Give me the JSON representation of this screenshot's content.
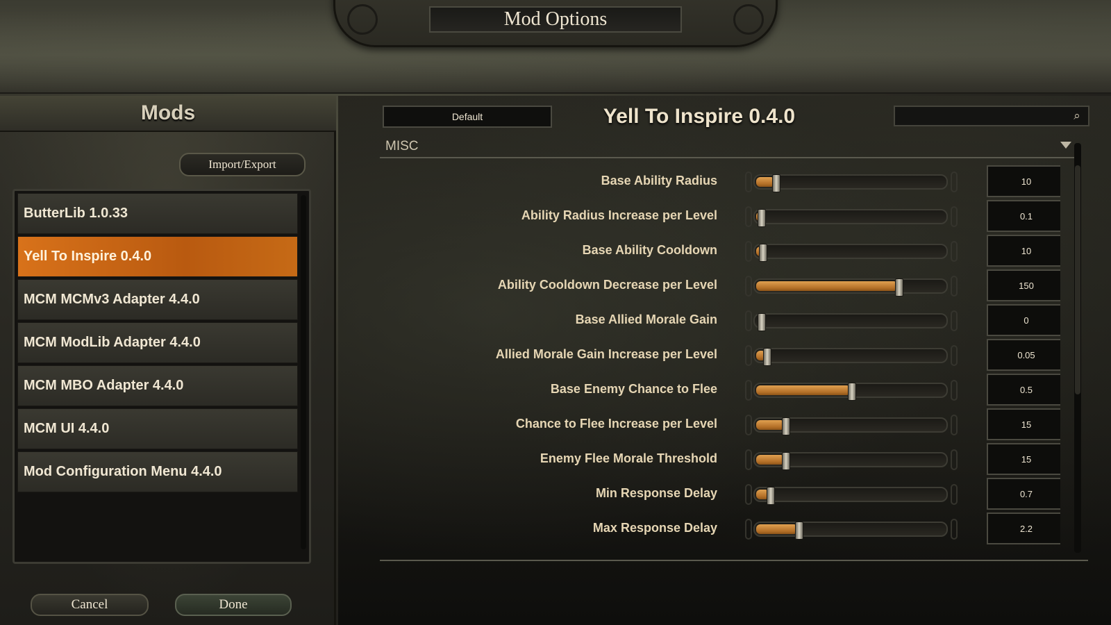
{
  "window": {
    "title": "Mod Options"
  },
  "mods_panel": {
    "header": "Mods",
    "import_export_label": "Import/Export",
    "items": [
      {
        "label": "ButterLib 1.0.33",
        "active": false
      },
      {
        "label": "Yell To Inspire 0.4.0",
        "active": true
      },
      {
        "label": "MCM MCMv3 Adapter 4.4.0",
        "active": false
      },
      {
        "label": "MCM ModLib Adapter 4.4.0",
        "active": false
      },
      {
        "label": "MCM MBO Adapter 4.4.0",
        "active": false
      },
      {
        "label": "MCM UI 4.4.0",
        "active": false
      },
      {
        "label": "Mod Configuration Menu 4.4.0",
        "active": false
      }
    ],
    "cancel_label": "Cancel",
    "done_label": "Done"
  },
  "settings_panel": {
    "preset_label": "Default",
    "mod_title": "Yell To Inspire 0.4.0",
    "search_placeholder": "",
    "search_icon": "magnifier-icon",
    "group_label": "MISC",
    "settings": [
      {
        "label": "Base Ability Radius",
        "value": "10",
        "fill": 0.1
      },
      {
        "label": "Ability Radius Increase per Level",
        "value": "0.1",
        "fill": 0.01
      },
      {
        "label": "Base Ability Cooldown",
        "value": "10",
        "fill": 0.03
      },
      {
        "label": "Ability Cooldown Decrease per Level",
        "value": "150",
        "fill": 0.75
      },
      {
        "label": "Base Allied Morale Gain",
        "value": "0",
        "fill": 0.0
      },
      {
        "label": "Allied Morale Gain Increase per Level",
        "value": "0.05",
        "fill": 0.05
      },
      {
        "label": "Base Enemy Chance to Flee",
        "value": "0.5",
        "fill": 0.5
      },
      {
        "label": "Chance to Flee Increase per Level",
        "value": "15",
        "fill": 0.15
      },
      {
        "label": "Enemy Flee Morale Threshold",
        "value": "15",
        "fill": 0.15
      },
      {
        "label": "Min Response Delay",
        "value": "0.7",
        "fill": 0.07
      },
      {
        "label": "Max Response Delay",
        "value": "2.2",
        "fill": 0.22
      }
    ]
  },
  "colors": {
    "accent": "#d8721a",
    "slider_fill": "#c08030",
    "text": "#e6d6b4"
  }
}
